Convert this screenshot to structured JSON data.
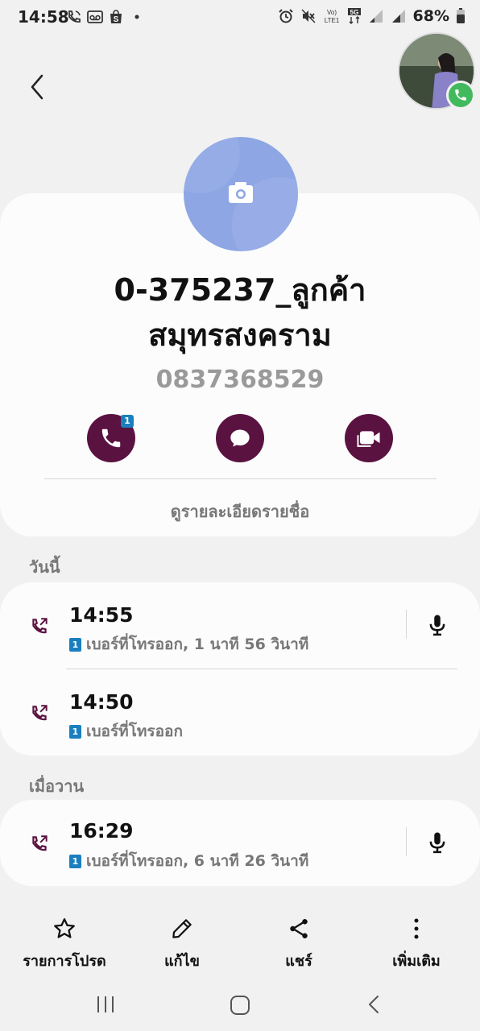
{
  "status_bar": {
    "time": "14:58",
    "battery": "68%",
    "network_labels": [
      "Vo)",
      "LTE1",
      "5G"
    ]
  },
  "contact": {
    "name_line1": "0-375237_ลูกค้า",
    "name_line2": "สมุทรสงคราม",
    "number": "0837368529",
    "call_count": "1",
    "view_details": "ดูรายละเอียดรายชื่อ",
    "avatar_color": "#8ea6e3",
    "accent_color": "#5a1240"
  },
  "sections": {
    "today": "วันนี้",
    "yesterday": "เมื่อวาน"
  },
  "call_log": {
    "today": [
      {
        "time": "14:55",
        "sim": "1",
        "detail": "เบอร์ที่โทรออก, 1 นาที 56 วินาที",
        "has_recording": true
      },
      {
        "time": "14:50",
        "sim": "1",
        "detail": "เบอร์ที่โทรออก",
        "has_recording": false
      }
    ],
    "yesterday": [
      {
        "time": "16:29",
        "sim": "1",
        "detail": "เบอร์ที่โทรออก, 6 นาที 26 วินาที",
        "has_recording": true
      }
    ]
  },
  "bottom_actions": {
    "favorites": "รายการโปรด",
    "edit": "แก้ไข",
    "share": "แชร์",
    "more": "เพิ่มเติม"
  }
}
